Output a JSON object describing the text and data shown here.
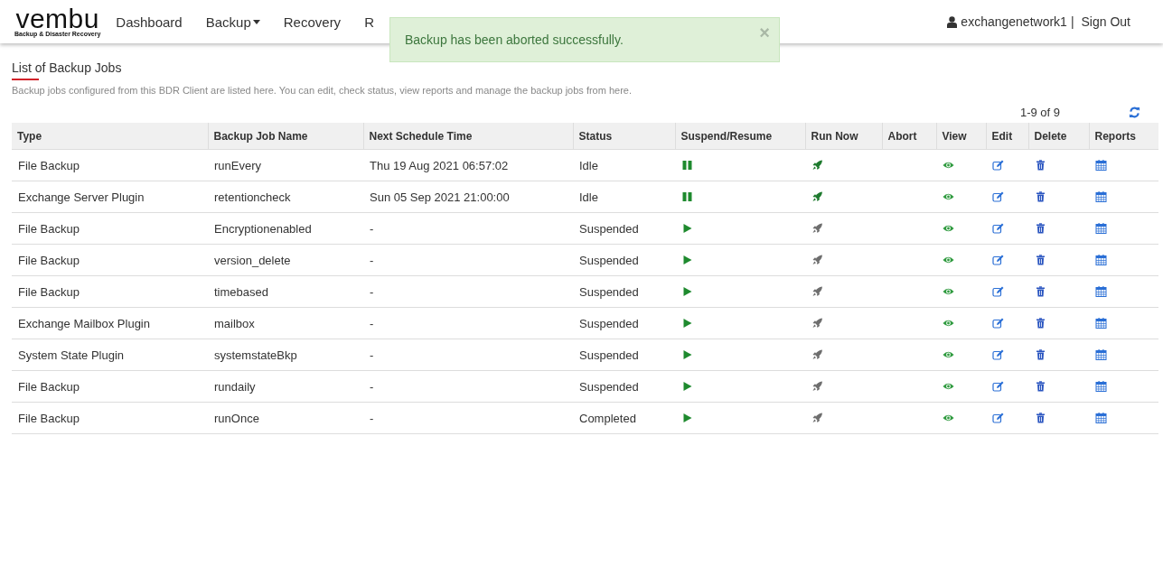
{
  "header": {
    "logo": "vembu",
    "logo_tagline": "Backup & Disaster Recovery",
    "nav": [
      {
        "label": "Dashboard"
      },
      {
        "label": "Backup",
        "dropdown": true
      },
      {
        "label": "Recovery"
      },
      {
        "label": "R"
      }
    ],
    "user": "exchangenetwork1",
    "separator": "|",
    "sign_out": "Sign Out"
  },
  "toast": {
    "message": "Backup has been aborted successfully.",
    "close": "×"
  },
  "page": {
    "title": "List of Backup Jobs",
    "description": "Backup jobs configured from this BDR Client are listed here. You can edit, check status, view reports and manage the backup jobs from here.",
    "pagination": "1-9 of 9"
  },
  "table": {
    "columns": [
      "Type",
      "Backup Job Name",
      "Next Schedule Time",
      "Status",
      "Suspend/Resume",
      "Run Now",
      "Abort",
      "View",
      "Edit",
      "Delete",
      "Reports"
    ],
    "rows": [
      {
        "type": "File Backup",
        "name": "runEvery",
        "next": "Thu 19 Aug 2021 06:57:02",
        "status": "Idle",
        "suspended": false,
        "run_enabled": true
      },
      {
        "type": "Exchange Server Plugin",
        "name": "retentioncheck",
        "next": "Sun 05 Sep 2021 21:00:00",
        "status": "Idle",
        "suspended": false,
        "run_enabled": true
      },
      {
        "type": "File Backup",
        "name": "Encryptionenabled",
        "next": "-",
        "status": "Suspended",
        "suspended": true,
        "run_enabled": false
      },
      {
        "type": "File Backup",
        "name": "version_delete",
        "next": "-",
        "status": "Suspended",
        "suspended": true,
        "run_enabled": false
      },
      {
        "type": "File Backup",
        "name": "timebased",
        "next": "-",
        "status": "Suspended",
        "suspended": true,
        "run_enabled": false
      },
      {
        "type": "Exchange Mailbox Plugin",
        "name": "mailbox",
        "next": "-",
        "status": "Suspended",
        "suspended": true,
        "run_enabled": false
      },
      {
        "type": "System State Plugin",
        "name": "systemstateBkp",
        "next": "-",
        "status": "Suspended",
        "suspended": true,
        "run_enabled": false
      },
      {
        "type": "File Backup",
        "name": "rundaily",
        "next": "-",
        "status": "Suspended",
        "suspended": true,
        "run_enabled": false
      },
      {
        "type": "File Backup",
        "name": "runOnce",
        "next": "-",
        "status": "Completed",
        "suspended": true,
        "run_enabled": false
      }
    ]
  }
}
